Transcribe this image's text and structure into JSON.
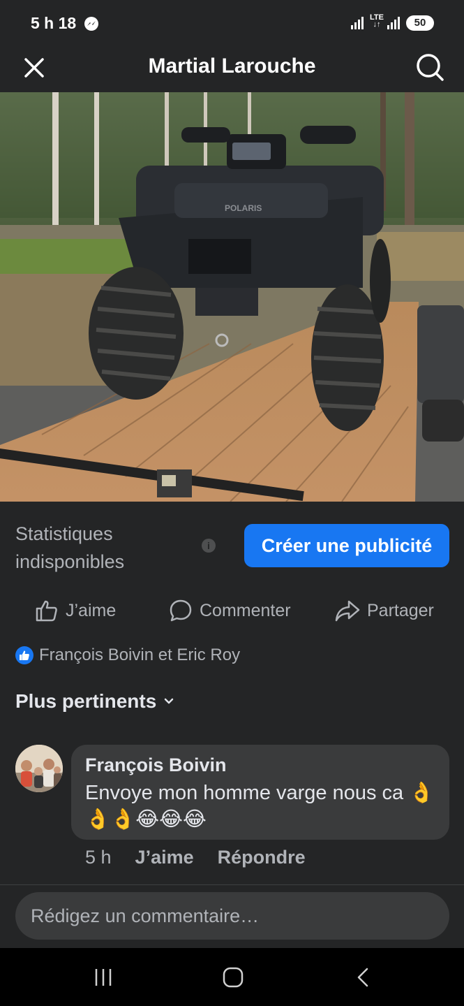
{
  "status_bar": {
    "time": "5 h 18",
    "network": "LTE",
    "battery": "50"
  },
  "header": {
    "title": "Martial Larouche",
    "close_icon": "close-icon",
    "search_icon": "search-icon"
  },
  "photo": {
    "brand_text": "POLARIS"
  },
  "stats": {
    "label": "Statistiques indisponibles",
    "info_icon": "i",
    "create_ad_label": "Créer une publicité"
  },
  "actions": {
    "like": "J’aime",
    "comment": "Commenter",
    "share": "Partager"
  },
  "reactions": {
    "names": "François Boivin et Eric Roy"
  },
  "sort": {
    "label": "Plus pertinents"
  },
  "comments": [
    {
      "author": "François Boivin",
      "text": "Envoye mon homme varge nous ca 👌👌👌😂😂😂",
      "time": "5 h",
      "like_label": "J’aime",
      "reply_label": "Répondre"
    }
  ],
  "composer": {
    "placeholder": "Rédigez un commentaire…"
  },
  "colors": {
    "background": "#242526",
    "bubble": "#3a3b3c",
    "accent": "#1877f2",
    "secondary_text": "#b0b3b8",
    "primary_text": "#e4e6eb"
  }
}
